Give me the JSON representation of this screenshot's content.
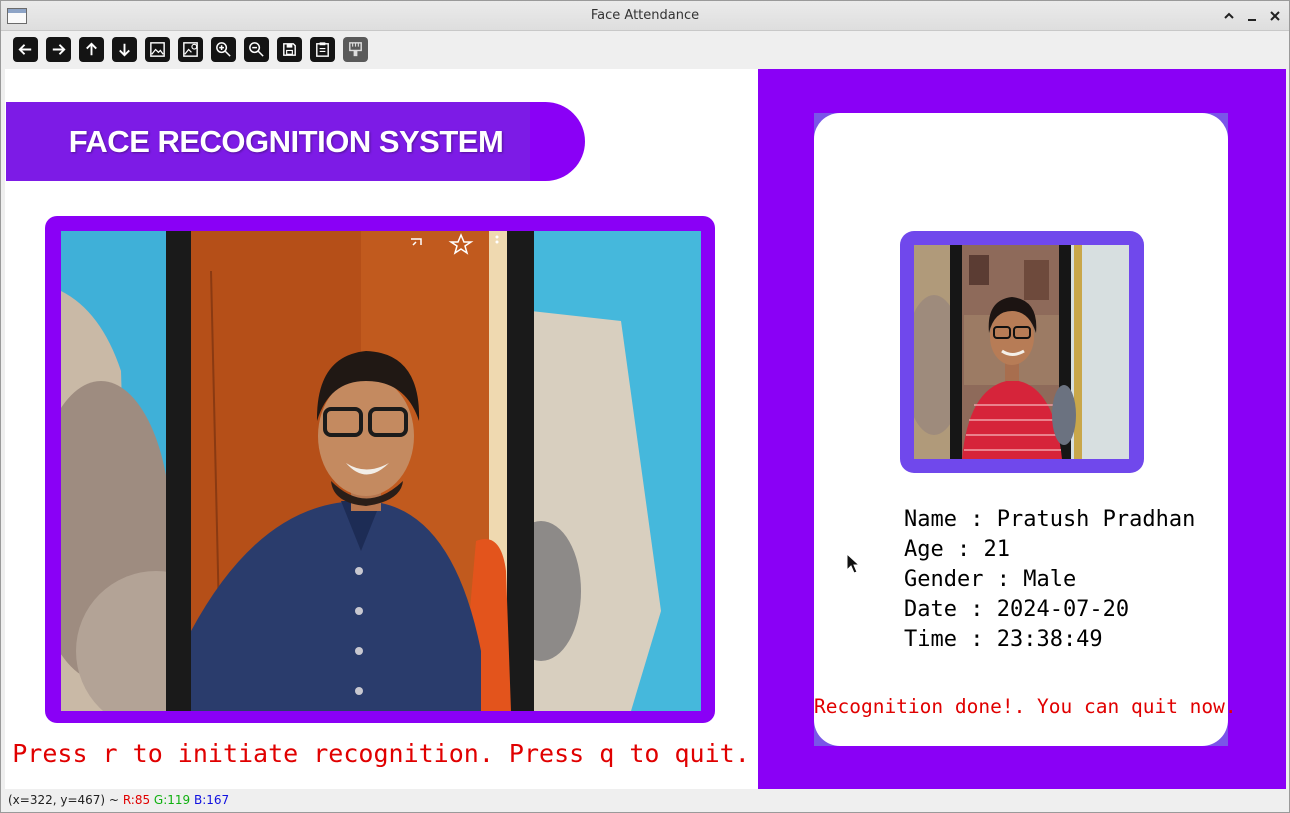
{
  "window": {
    "title": "Face Attendance"
  },
  "toolbar": {
    "buttons": [
      "arrow-left-icon",
      "arrow-right-icon",
      "arrow-up-icon",
      "arrow-down-icon",
      "image-icon",
      "image-settings-icon",
      "zoom-in-icon",
      "zoom-out-icon",
      "save-icon",
      "clipboard-icon",
      "properties-icon"
    ]
  },
  "banner": {
    "title": "FACE RECOGNITION SYSTEM"
  },
  "instruction": "Press r to initiate recognition. Press q to quit.",
  "profile": {
    "name_line": "Name : Pratush Pradhan",
    "age_line": "Age : 21",
    "gender_line": "Gender : Male",
    "date_line": "Date : 2024-07-20",
    "time_line": "Time : 23:38:49"
  },
  "status_message": "Recognition done!. You can quit now.",
  "statusbar": {
    "coords": "(x=322, y=467) ~",
    "r": "R:85",
    "g": "G:119",
    "b": "B:167"
  },
  "colors": {
    "accent_purple": "#8a00f6",
    "photo_frame": "#7048ec",
    "alert_red": "#e00000"
  }
}
